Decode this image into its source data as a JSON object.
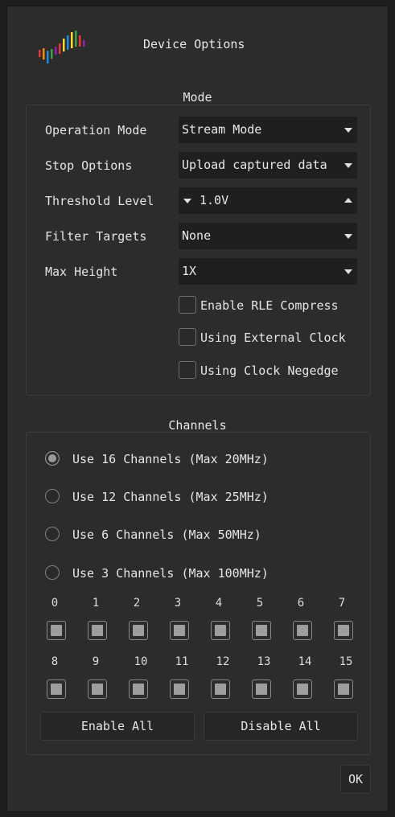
{
  "dialog": {
    "title": "Device Options"
  },
  "mode": {
    "group_title": "Mode",
    "operation_mode": {
      "label": "Operation Mode",
      "value": "Stream Mode"
    },
    "stop_options": {
      "label": "Stop Options",
      "value": "Upload captured data"
    },
    "threshold_level": {
      "label": "Threshold Level",
      "value": "1.0V"
    },
    "filter_targets": {
      "label": "Filter Targets",
      "value": "None"
    },
    "max_height": {
      "label": "Max Height",
      "value": "1X"
    },
    "checkboxes": [
      {
        "label": "Enable RLE Compress",
        "checked": false
      },
      {
        "label": "Using External Clock",
        "checked": false
      },
      {
        "label": "Using Clock Negedge",
        "checked": false
      }
    ]
  },
  "channels": {
    "group_title": "Channels",
    "options": [
      {
        "label": "Use 16 Channels (Max 20MHz)",
        "checked": true
      },
      {
        "label": "Use 12 Channels (Max 25MHz)",
        "checked": false
      },
      {
        "label": "Use 6 Channels (Max 50MHz)",
        "checked": false
      },
      {
        "label": "Use 3 Channels (Max 100MHz)",
        "checked": false
      }
    ],
    "row1": [
      "0",
      "1",
      "2",
      "3",
      "4",
      "5",
      "6",
      "7"
    ],
    "row2": [
      "8",
      "9",
      "10",
      "11",
      "12",
      "13",
      "14",
      "15"
    ],
    "enable_all": "Enable All",
    "disable_all": "Disable All"
  },
  "ok_label": "OK",
  "colors": {
    "background": "#2c2c2c",
    "combo": "#1f1f1f",
    "text": "#e6e6e6"
  }
}
